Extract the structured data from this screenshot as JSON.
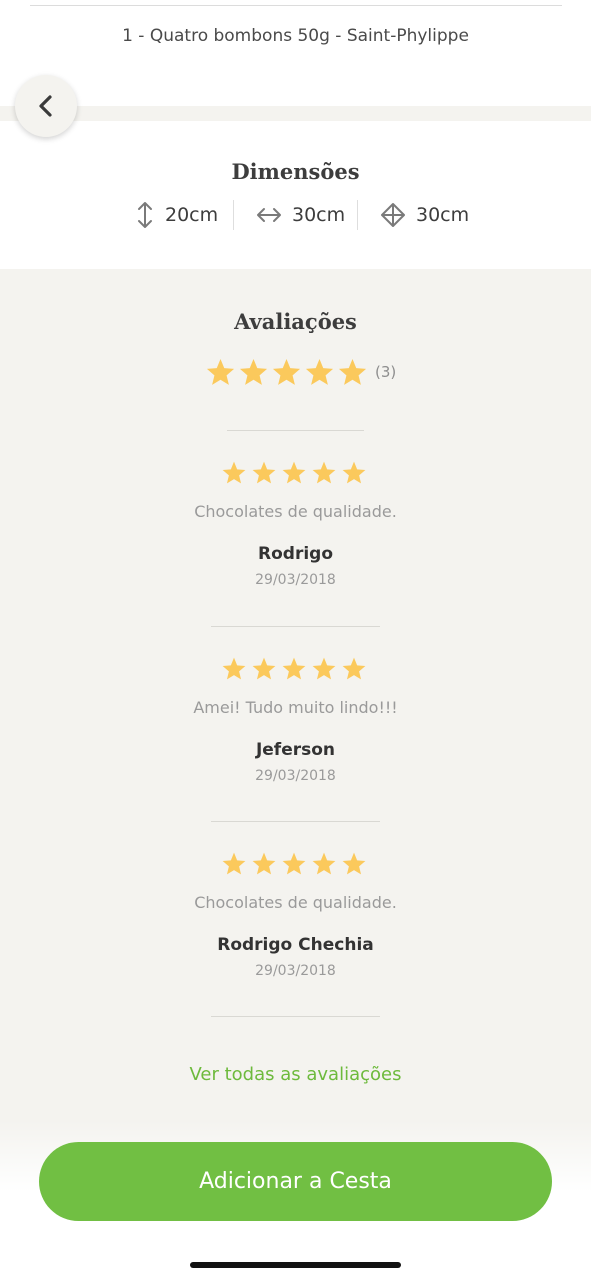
{
  "product": {
    "contents_item": "1 - Quatro bombons 50g - Saint-Phylippe"
  },
  "navigation": {
    "back_icon": "chevron-left-icon"
  },
  "dimensions": {
    "title": "Dimensões",
    "items": [
      {
        "icon": "vertical-arrow-icon",
        "value": "20cm"
      },
      {
        "icon": "horizontal-arrow-icon",
        "value": "30cm"
      },
      {
        "icon": "depth-diamond-icon",
        "value": "30cm"
      }
    ]
  },
  "reviews": {
    "title": "Avaliações",
    "average_rating": 5,
    "max_rating": 5,
    "count_label": "(3)",
    "star_color": "#fbc95c",
    "items": [
      {
        "rating": 5,
        "text": "Chocolates de qualidade.",
        "author": "Rodrigo",
        "date": "29/03/2018"
      },
      {
        "rating": 5,
        "text": "Amei! Tudo muito lindo!!!",
        "author": "Jeferson",
        "date": "29/03/2018"
      },
      {
        "rating": 5,
        "text": "Chocolates de qualidade.",
        "author": "Rodrigo Chechia",
        "date": "29/03/2018"
      }
    ],
    "see_all_label": "Ver todas as avaliações"
  },
  "actions": {
    "add_to_cart_label": "Adicionar a Cesta"
  },
  "colors": {
    "accent_green": "#71bf43",
    "link_green": "#6dba3c",
    "page_background": "#f4f3ef"
  }
}
